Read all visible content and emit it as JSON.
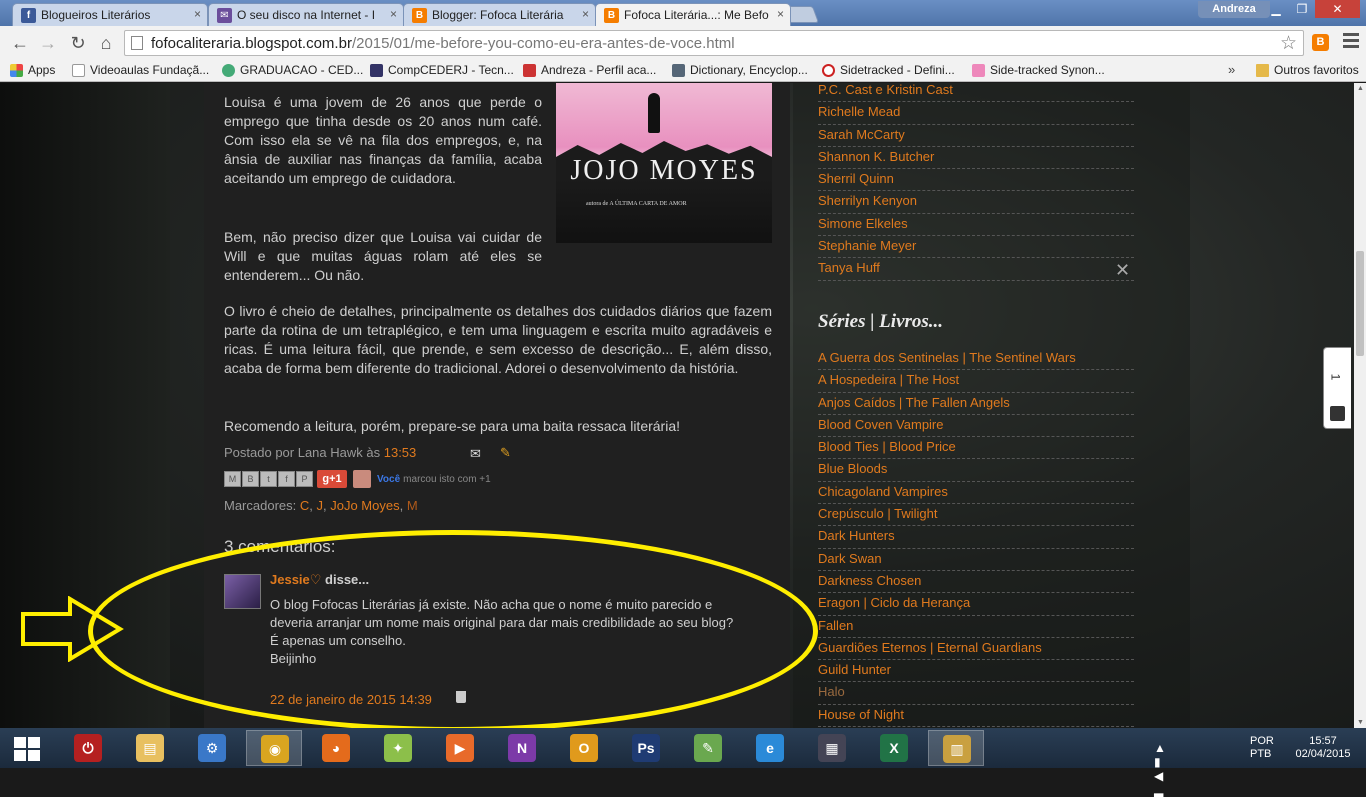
{
  "tabs": [
    {
      "title": "Blogueiros Literários",
      "favicon": "facebook-icon",
      "color": "#3b5998",
      "glyph": "f"
    },
    {
      "title": "O seu disco na Internet - I",
      "favicon": "mail-icon",
      "color": "#6b4e9b",
      "glyph": "✉"
    },
    {
      "title": "Blogger: Fofoca Literária",
      "favicon": "blogger-icon",
      "color": "#f57d00",
      "glyph": "B"
    },
    {
      "title": "Fofoca Literária...: Me Befo",
      "favicon": "blogger-icon",
      "color": "#f57d00",
      "glyph": "B",
      "active": true
    }
  ],
  "window": {
    "user": "Andreza"
  },
  "address": {
    "host": "fofocaliteraria.blogspot.com.br",
    "path": "/2015/01/me-before-you-como-eu-era-antes-de-voce.html"
  },
  "bookmarks": [
    {
      "label": "Apps",
      "icon": "apps-grid-icon",
      "color": "#d34"
    },
    {
      "label": "Videoaulas Fundaçã...",
      "icon": "page-icon",
      "color": "#fff"
    },
    {
      "label": "GRADUACAO - CED...",
      "icon": "g-logo-icon",
      "color": "#4a7"
    },
    {
      "label": "CompCEDERJ - Tecn...",
      "icon": "site-icon",
      "color": "#336"
    },
    {
      "label": "Andreza - Perfil aca...",
      "icon": "pen-icon",
      "color": "#c33"
    },
    {
      "label": "Dictionary, Encyclop...",
      "icon": "dictionary-icon",
      "color": "#567"
    },
    {
      "label": "Sidetracked - Defini...",
      "icon": "merriam-icon",
      "color": "#c22"
    },
    {
      "label": "Side-tracked Synon...",
      "icon": "thesaurus-icon",
      "color": "#e8b"
    }
  ],
  "bookmarks_more": "»",
  "bookmarks_other": "Outros favoritos",
  "post": {
    "para1": "Louisa é uma jovem de 26 anos que perde o emprego que tinha desde os 20 anos num café. Com isso ela se vê na fila dos empregos, e, na ânsia de auxiliar nas finanças da família, acaba aceitando um emprego de cuidadora.",
    "para2": "Bem, não preciso dizer que Louisa vai cuidar de Will e que muitas águas rolam até eles se entenderem... Ou não.",
    "para3": "O livro é cheio de detalhes, principalmente os detalhes dos cuidados diários que fazem parte da rotina de um tetraplégico, e tem uma linguagem e escrita muito agradáveis e ricas. É uma leitura fácil, que prende, e sem excesso de descrição... E, além disso, acaba de forma bem diferente do tradicional. Adorei o desenvolvimento da história.",
    "para4": "Recomendo a leitura, porém, prepare-se para uma baita ressaca literária!",
    "cover_author": "JOJO MOYES",
    "cover_sub": "autora de A ÚLTIMA CARTA DE AMOR",
    "posted_by": "Postado por Lana Hawk às",
    "time": "13:53",
    "gplus": "g+1",
    "you": "Você",
    "marked": "marcou isto com +1",
    "labels_prefix": "Marcadores:",
    "labels": [
      "C",
      "J",
      "JoJo Moyes",
      "M"
    ]
  },
  "comments": {
    "heading": "3 comentários:",
    "author": "Jessie♡",
    "said": " disse...",
    "body": [
      "O blog Fofocas Literárias já existe. Não acha que o nome é muito parecido e deveria arranjar um nome mais original para dar mais credibilidade ao seu blog?",
      "É apenas um conselho.",
      "Beijinho"
    ],
    "date": "22 de janeiro de 2015 14:39"
  },
  "sidebar": {
    "authors": [
      "P.C. Cast e Kristin Cast",
      "Richelle Mead",
      "Sarah McCarty",
      "Shannon K. Butcher",
      "Sherril Quinn",
      "Sherrilyn Kenyon",
      "Simone Elkeles",
      "Stephanie Meyer",
      "Tanya Huff"
    ],
    "series_heading": "Séries | Livros...",
    "series": [
      "A Guerra dos Sentinelas | The Sentinel Wars",
      "A Hospedeira | The Host",
      "Anjos Caídos | The Fallen Angels",
      "Blood Coven Vampire",
      "Blood Ties | Blood Price",
      "Blue Bloods",
      "Chicagoland Vampires",
      "Crepúsculo | Twilight",
      "Dark Hunters",
      "Dark Swan",
      "Darkness Chosen",
      "Eragon | Ciclo da Herança",
      "Fallen",
      "Guardiões Eternos | Eternal Guardians",
      "Guild Hunter",
      "Halo",
      "House of Night"
    ]
  },
  "side_widget": {
    "number": "1"
  },
  "taskbar": {
    "apps": [
      {
        "name": "power-app-icon",
        "color": "#b52020",
        "glyph": "⏻"
      },
      {
        "name": "file-explorer-icon",
        "color": "#e8c060",
        "glyph": "▤"
      },
      {
        "name": "control-panel-icon",
        "color": "#3a78c8",
        "glyph": "⚙"
      },
      {
        "name": "chrome-icon",
        "color": "#d9a520",
        "glyph": "◉",
        "active": true
      },
      {
        "name": "firefox-icon",
        "color": "#e46b1c",
        "glyph": "◕"
      },
      {
        "name": "photos-icon",
        "color": "#8cbf4a",
        "glyph": "✦"
      },
      {
        "name": "media-player-icon",
        "color": "#e86a2a",
        "glyph": "▶"
      },
      {
        "name": "onenote-icon",
        "color": "#7c3aa8",
        "glyph": "N"
      },
      {
        "name": "outlook-icon",
        "color": "#e09a1c",
        "glyph": "O"
      },
      {
        "name": "photoshop-icon",
        "color": "#1f3b73",
        "glyph": "Ps"
      },
      {
        "name": "leaf-app-icon",
        "color": "#6aa84f",
        "glyph": "✎"
      },
      {
        "name": "ie-icon",
        "color": "#2b8ad8",
        "glyph": "e"
      },
      {
        "name": "network-app-icon",
        "color": "#445",
        "glyph": "▦"
      },
      {
        "name": "excel-icon",
        "color": "#217346",
        "glyph": "X"
      },
      {
        "name": "books-app-icon",
        "color": "#c9a040",
        "glyph": "▥",
        "active": true
      }
    ],
    "lang": [
      "POR",
      "PTB"
    ],
    "time": "15:57",
    "date": "02/04/2015"
  }
}
